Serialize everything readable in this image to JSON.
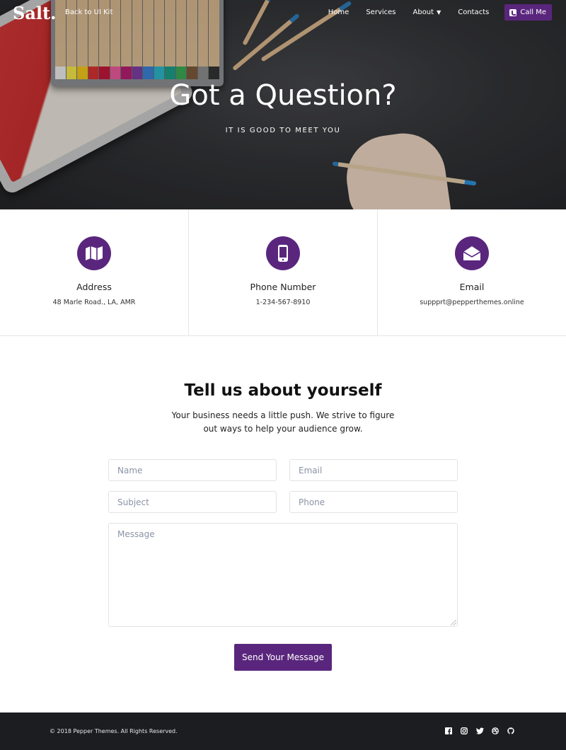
{
  "nav": {
    "logo": "Salt.",
    "back_link": "Back to UI Kit",
    "items": [
      {
        "label": "Home"
      },
      {
        "label": "Services"
      },
      {
        "label": "About"
      },
      {
        "label": "Contacts"
      }
    ],
    "call_button": "Call Me"
  },
  "hero": {
    "title": "Got a Question?",
    "subtitle": "IT IS GOOD TO MEET YOU"
  },
  "info_cards": [
    {
      "icon": "map-icon",
      "title": "Address",
      "value": "48 Marle Road., LA, AMR"
    },
    {
      "icon": "phone-icon",
      "title": "Phone Number",
      "value": "1-234-567-8910"
    },
    {
      "icon": "envelope-icon",
      "title": "Email",
      "value": "suppprt@pepperthemes.online"
    }
  ],
  "form": {
    "title": "Tell us about yourself",
    "description": "Your business needs a little push. We strive to figure out ways to help your audience grow.",
    "name_placeholder": "Name",
    "email_placeholder": "Email",
    "subject_placeholder": "Subject",
    "phone_placeholder": "Phone",
    "message_placeholder": "Message",
    "submit_label": "Send Your Message"
  },
  "footer": {
    "copyright": "© 2018 Pepper Themes. All Rights Reserved.",
    "socials": [
      "facebook-icon",
      "instagram-icon",
      "twitter-icon",
      "dribbble-icon",
      "github-icon"
    ]
  },
  "colors": {
    "accent": "#5a267d",
    "footer_bg": "#1c1d21"
  }
}
